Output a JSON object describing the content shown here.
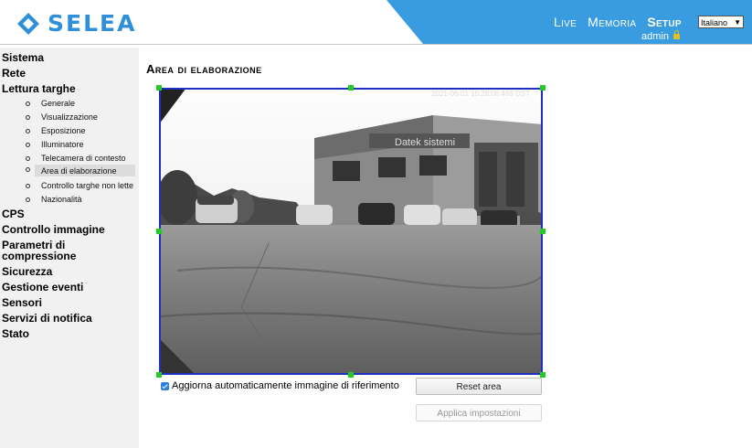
{
  "brand": {
    "name": "SELEA"
  },
  "nav": {
    "live": "Live",
    "memoria": "Memoria",
    "setup": "Setup"
  },
  "language": {
    "selected": "Italiano"
  },
  "user": {
    "name": "admin"
  },
  "sidebar": {
    "sections": [
      "Sistema",
      "Rete",
      "Lettura targhe",
      "CPS",
      "Controllo immagine",
      "Parametri di compressione",
      "Sicurezza",
      "Gestione eventi",
      "Sensori",
      "Servizi di notifica",
      "Stato"
    ],
    "lettura_targhe_items": [
      "Generale",
      "Visualizzazione",
      "Esposizione",
      "Illuminatore",
      "Telecamera di contesto",
      "Area di elaborazione",
      "Controllo targhe non lette",
      "Nazionalità"
    ],
    "selected_item": "Area di elaborazione"
  },
  "page": {
    "title": "Area di elaborazione",
    "timestamp": "2021-06-01 15:28:06.465 DST",
    "building_sign": "Datek sistemi",
    "checkbox_label": "Aggiorna automaticamente immagine di riferimento",
    "checkbox_checked": true,
    "reset_label": "Reset area",
    "apply_label": "Applica impostazioni"
  },
  "colors": {
    "accent": "#3a9ce0",
    "logo": "#2f8fd8",
    "area_border": "#2030c0",
    "handle": "#22cc22"
  }
}
